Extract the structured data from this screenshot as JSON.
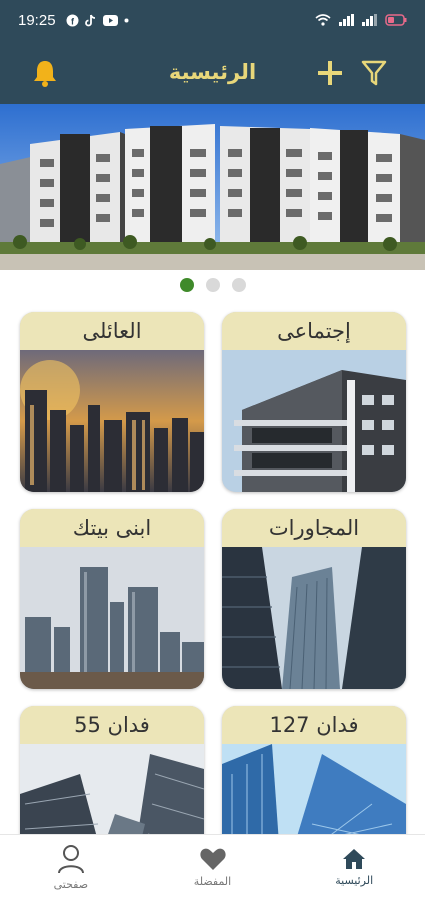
{
  "status_bar": {
    "time": "19:25"
  },
  "app_bar": {
    "title": "الرئيسية"
  },
  "banner": {
    "dots": 3,
    "active_dot": 0
  },
  "cards": [
    {
      "label": "إجتماعى",
      "image": "modern-building-photo"
    },
    {
      "label": "العائلى",
      "image": "sunset-city-skyline-photo"
    },
    {
      "label": "المجاورات",
      "image": "glass-tower-photo"
    },
    {
      "label": "ابنى بيتك",
      "image": "downtown-skyline-photo"
    },
    {
      "label": "127 فدان",
      "image": "blue-glass-skyscraper-photo"
    },
    {
      "label": "55 فدان",
      "image": "glass-towers-upward-photo"
    }
  ],
  "bottom_nav": {
    "items": [
      {
        "label": "الرئيسية",
        "icon": "home-icon"
      },
      {
        "label": "المفضلة",
        "icon": "heart-icon"
      },
      {
        "label": "صفحتى",
        "icon": "person-icon"
      }
    ]
  },
  "colors": {
    "bar": "#2f4a5a",
    "accent": "#e8d77a",
    "card_label_bg": "#ece5b8",
    "active_dot": "#3f8a2a"
  }
}
